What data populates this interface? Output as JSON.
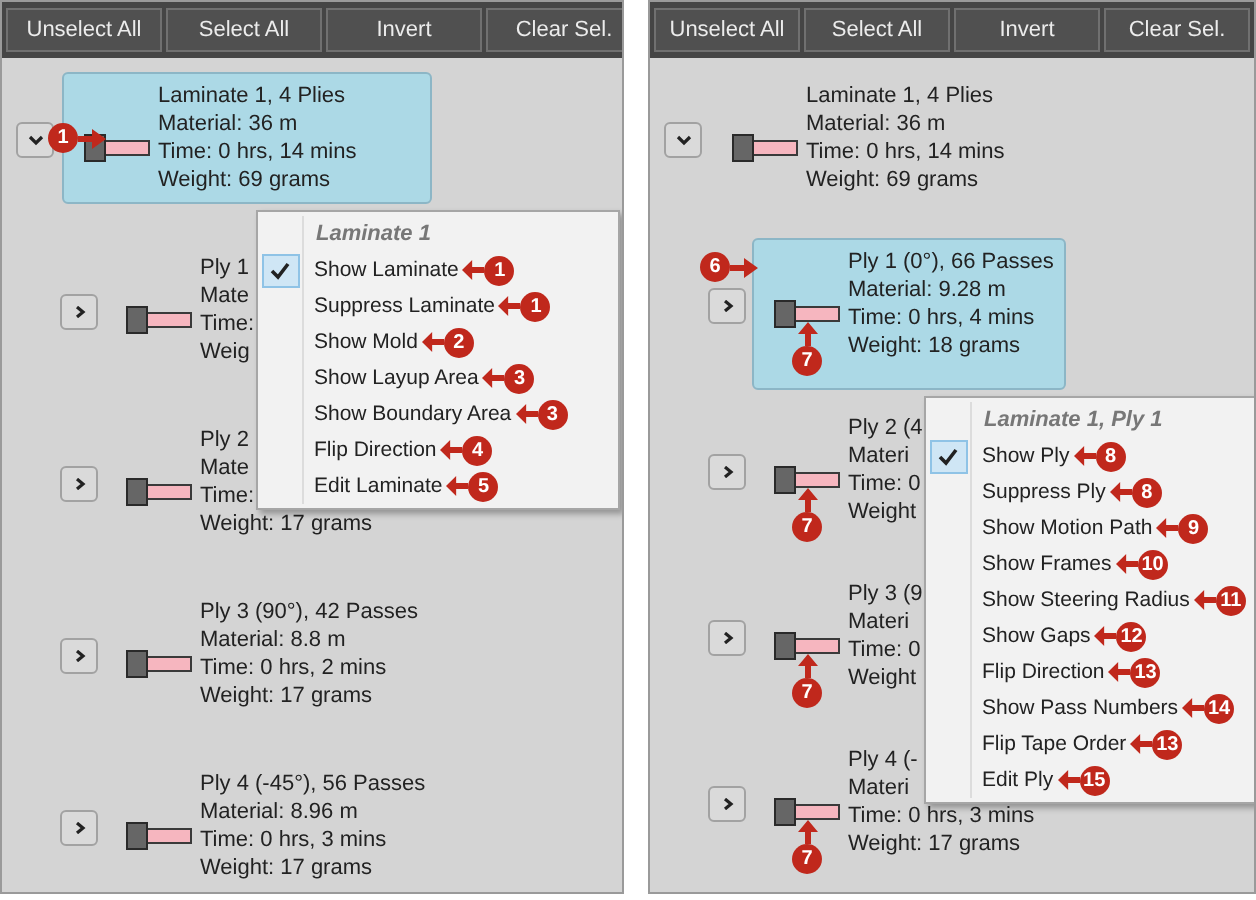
{
  "panels": [
    {
      "toolbar": [
        "Unselect All",
        "Select All",
        "Invert",
        "Clear Sel."
      ],
      "tree": [
        {
          "lines": [
            "Laminate 1, 4 Plies",
            "Material: 36 m",
            "Time: 0 hrs, 14 mins",
            "Weight: 69 grams"
          ],
          "selected": true,
          "expanded": true,
          "callout": {
            "number": "1",
            "kind": "side"
          },
          "children": [
            {
              "lines": [
                "Ply 1",
                "Mate",
                "Time:",
                "Weig"
              ],
              "selected": false,
              "expanded": false
            },
            {
              "lines": [
                "Ply 2",
                "Mate",
                "Time:",
                "Weight: 17 grams"
              ],
              "selected": false,
              "expanded": false
            },
            {
              "lines": [
                "Ply 3 (90°), 42 Passes",
                "Material: 8.8 m",
                "Time: 0 hrs, 2 mins",
                "Weight: 17 grams"
              ],
              "selected": false,
              "expanded": false
            },
            {
              "lines": [
                "Ply 4 (-45°), 56 Passes",
                "Material: 8.96 m",
                "Time: 0 hrs, 3 mins",
                "Weight: 17 grams"
              ],
              "selected": false,
              "expanded": false
            }
          ]
        }
      ],
      "menu": {
        "title": "Laminate 1",
        "items": [
          {
            "label": "Show Laminate",
            "checked": true,
            "callout": "1"
          },
          {
            "label": "Suppress Laminate",
            "checked": false,
            "callout": "1"
          },
          {
            "label": "Show Mold",
            "checked": false,
            "callout": "2"
          },
          {
            "label": "Show Layup Area",
            "checked": false,
            "callout": "3"
          },
          {
            "label": "Show Boundary Area",
            "checked": false,
            "callout": "3"
          },
          {
            "label": "Flip Direction",
            "checked": false,
            "callout": "4"
          },
          {
            "label": "Edit Laminate",
            "checked": false,
            "callout": "5"
          }
        ]
      }
    },
    {
      "toolbar": [
        "Unselect All",
        "Select All",
        "Invert",
        "Clear Sel."
      ],
      "tree": [
        {
          "lines": [
            "Laminate 1, 4 Plies",
            "Material: 36 m",
            "Time: 0 hrs, 14 mins",
            "Weight: 69 grams"
          ],
          "selected": false,
          "expanded": true,
          "children": [
            {
              "lines": [
                "Ply 1 (0°), 66 Passes",
                "Material: 9.28 m",
                "Time: 0 hrs, 4 mins",
                "Weight: 18 grams"
              ],
              "selected": true,
              "expanded": false,
              "callout": {
                "number": "6",
                "kind": "corner"
              },
              "callout_below": "7"
            },
            {
              "lines": [
                "Ply 2 (4",
                "Materi",
                "Time: 0",
                "Weight"
              ],
              "selected": false,
              "expanded": false,
              "callout_below": "7"
            },
            {
              "lines": [
                "Ply 3 (9",
                "Materi",
                "Time: 0",
                "Weight"
              ],
              "selected": false,
              "expanded": false,
              "callout_below": "7"
            },
            {
              "lines": [
                "Ply 4 (-",
                "Materi",
                "Time: 0 hrs, 3 mins",
                "Weight: 17 grams"
              ],
              "selected": false,
              "expanded": false,
              "callout_below": "7"
            }
          ]
        }
      ],
      "menu": {
        "title": "Laminate 1, Ply 1",
        "items": [
          {
            "label": "Show Ply",
            "checked": true,
            "callout": "8"
          },
          {
            "label": "Suppress Ply",
            "checked": false,
            "callout": "8"
          },
          {
            "label": "Show Motion Path",
            "checked": false,
            "callout": "9"
          },
          {
            "label": "Show Frames",
            "checked": false,
            "callout": "10"
          },
          {
            "label": "Show Steering Radius",
            "checked": false,
            "callout": "11"
          },
          {
            "label": "Show Gaps",
            "checked": false,
            "callout": "12"
          },
          {
            "label": "Flip Direction",
            "checked": false,
            "callout": "13"
          },
          {
            "label": "Show Pass Numbers",
            "checked": false,
            "callout": "14"
          },
          {
            "label": "Flip Tape Order",
            "checked": false,
            "callout": "13"
          },
          {
            "label": "Edit Ply",
            "checked": false,
            "callout": "15"
          }
        ]
      }
    }
  ]
}
